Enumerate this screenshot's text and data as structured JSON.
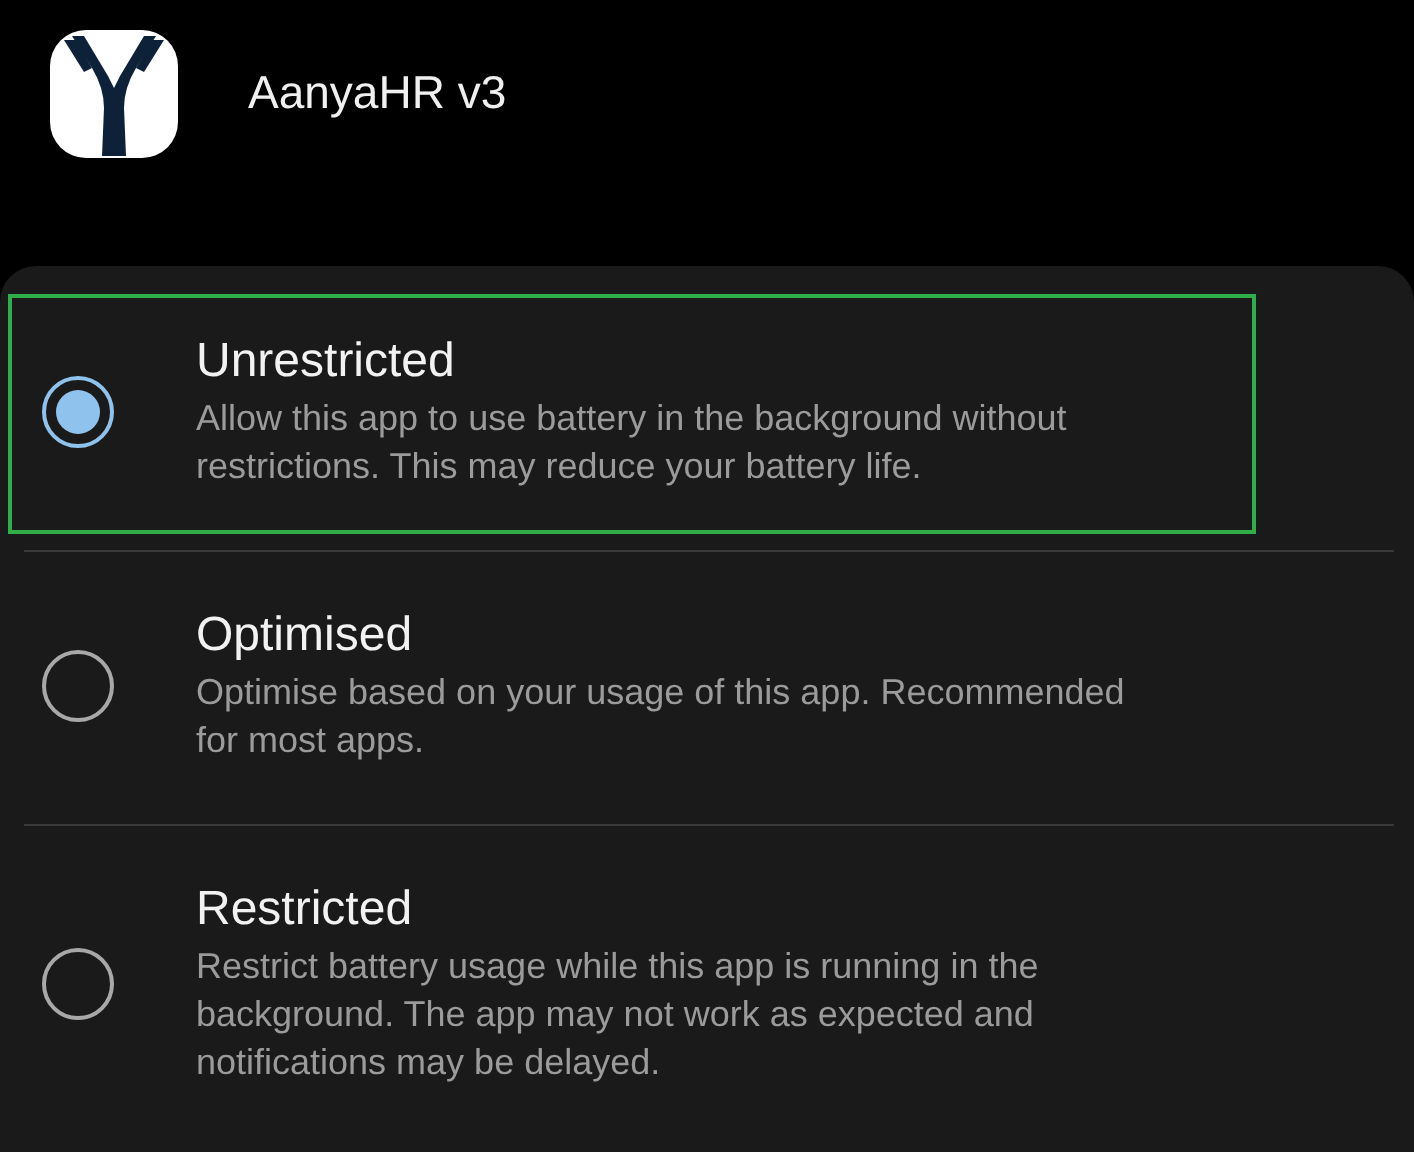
{
  "app": {
    "name": "AanyaHR v3"
  },
  "options": [
    {
      "title": "Unrestricted",
      "description": "Allow this app to use battery in the background without restrictions. This may reduce your battery life.",
      "selected": true,
      "highlighted": true
    },
    {
      "title": "Optimised",
      "description": "Optimise based on your usage of this app. Recommended for most apps.",
      "selected": false,
      "highlighted": false
    },
    {
      "title": "Restricted",
      "description": "Restrict battery usage while this app is running in the background. The app may not work as expected and notifications may be delayed.",
      "selected": false,
      "highlighted": false
    }
  ]
}
